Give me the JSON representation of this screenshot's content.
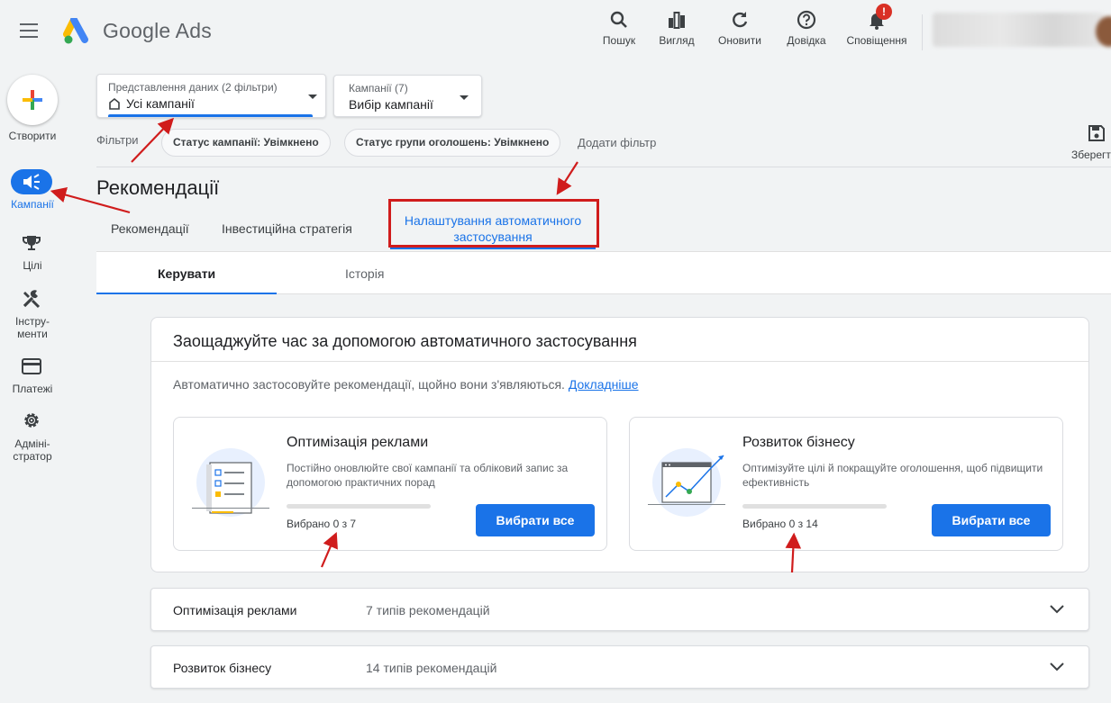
{
  "app": {
    "brand": "Google Ads"
  },
  "toolbar": {
    "search": "Пошук",
    "view": "Вигляд",
    "refresh": "Оновити",
    "help": "Довідка",
    "notifications": "Сповіщення",
    "notifications_badge": "!"
  },
  "nav": {
    "create": "Створити",
    "campaigns": "Кампанії",
    "goals": "Цілі",
    "tools": "Інстру-\nменти",
    "billing": "Платежі",
    "admin": "Адміні-\nстратор"
  },
  "view_select": {
    "label": "Представлення даних (2 фільтри)",
    "value": "Усі кампанії"
  },
  "campaign_select": {
    "label": "Кампанії (7)",
    "value": "Вибір кампанії"
  },
  "filters": {
    "label": "Фільтри",
    "chips": [
      "Статус кампанії: Увімкнено",
      "Статус групи оголошень: Увімкнено"
    ],
    "add": "Додати фільтр",
    "save": "Зберегти"
  },
  "page": {
    "title": "Рекомендації"
  },
  "tabs": [
    {
      "label": "Рекомендації"
    },
    {
      "label": "Інвестиційна стратегія"
    },
    {
      "label": "Налаштування автоматичного застосування"
    }
  ],
  "subtabs": [
    {
      "label": "Керувати"
    },
    {
      "label": "Історія"
    }
  ],
  "card": {
    "title": "Заощаджуйте час за допомогою автоматичного застосування",
    "desc": "Автоматично застосовуйте рекомендації, щойно вони з'являються.",
    "link": "Докладніше",
    "optimization": {
      "title": "Оптимізація реклами",
      "desc": "Постійно оновлюйте свої кампанії та обліковий запис за допомогою практичних порад",
      "selected": "Вибрано 0 з 7",
      "progress": 0,
      "button": "Вибрати все"
    },
    "growth": {
      "title": "Розвиток бізнесу",
      "desc": "Оптимізуйте цілі й покращуйте оголошення, щоб підвищити ефективність",
      "selected": "Вибрано 0 з 14",
      "progress": 0,
      "button": "Вибрати все"
    }
  },
  "accordions": [
    {
      "name": "Оптимізація реклами",
      "count": "7 типів рекомендацій"
    },
    {
      "name": "Розвиток бізнесу",
      "count": "14 типів рекомендацій"
    }
  ],
  "colors": {
    "accent": "#1a73e8",
    "annotation": "#d01c1c",
    "badge": "#d93025"
  }
}
